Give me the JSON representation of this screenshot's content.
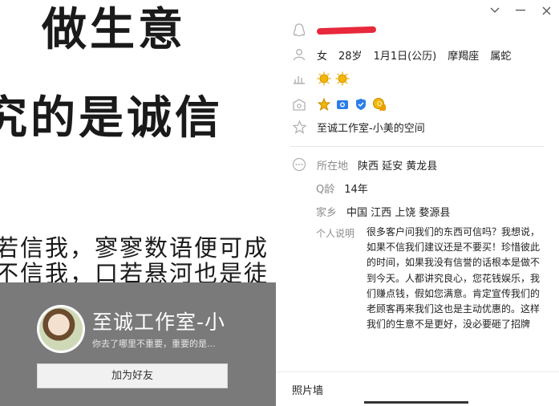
{
  "cover": {
    "line1": "做生意",
    "line2": "究的是诚信",
    "line3": "若信我，寥寥数语便可成",
    "line4": "不信我，口若悬河也是徒"
  },
  "card": {
    "nickname": "至诚工作室-小",
    "signature": "你去了哪里不重要，重要的是...",
    "add_friend": "加为好友"
  },
  "profile": {
    "gender": "女",
    "age": "28岁",
    "birthday": "1月1日(公历)",
    "zodiac": "摩羯座",
    "chinese_zodiac": "属蛇",
    "space_link": "至诚工作室-小美的空间"
  },
  "details": {
    "location_label": "所在地",
    "location_value": "陕西 延安 黄龙县",
    "qage_label": "Q龄",
    "qage_value": "14年",
    "hometown_label": "家乡",
    "hometown_value": "中国 江西 上饶 婺源县",
    "bio_label": "个人说明",
    "bio": "很多客户问我们的东西可信吗？我想说，如果不信我们建议还是不要买！珍惜彼此的时间，如果我没有信誉的话根本是做不到今天。人都讲究良心，您花钱娱乐，我们赚点钱，假如您满意。肯定宣传我们的老顾客再来我们这也是主动优惠的。这样我们的生意不是更好，没必要砸了招牌"
  },
  "photo_wall": {
    "label": "照片墙"
  },
  "colors": {
    "card_bg": "#7a7a7a",
    "redaction": "#e8283b",
    "sun_badge": "#f2b705",
    "blue_badge": "#2b7de9"
  },
  "icons": [
    "chevron-down-icon",
    "minimize-icon",
    "close-icon",
    "penguin-icon",
    "person-icon",
    "level-chart-icon",
    "badges-icon",
    "star-icon",
    "more-icon"
  ]
}
